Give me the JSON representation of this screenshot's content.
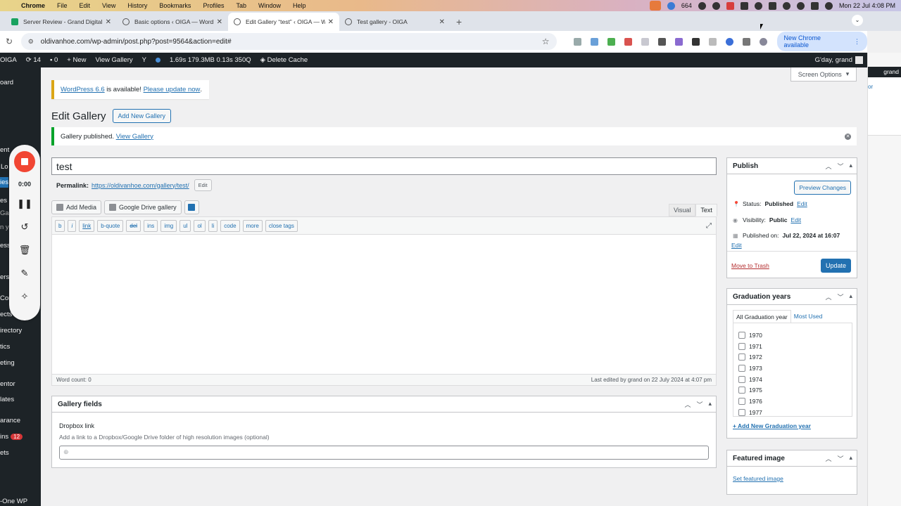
{
  "mac": {
    "menu": [
      "Chrome",
      "File",
      "Edit",
      "View",
      "History",
      "Bookmarks",
      "Profiles",
      "Tab",
      "Window",
      "Help"
    ],
    "count": "664",
    "datetime": "Mon 22 Jul  4:08 PM"
  },
  "tabs": [
    {
      "title": "Server Review - Grand Digital",
      "icon": "sheets-icon"
    },
    {
      "title": "Basic options ‹ OIGA — WordPress",
      "icon": "wordpress-icon"
    },
    {
      "title": "Edit Gallery “test” ‹ OIGA — WordPress",
      "icon": "wordpress-icon"
    },
    {
      "title": "Test gallery - OIGA",
      "icon": "wordpress-icon"
    }
  ],
  "address": {
    "url": "oldivanhoe.com/wp-admin/post.php?post=9564&action=edit#",
    "new_chrome": "New Chrome available"
  },
  "adminbar": {
    "site": "OIGA",
    "updates": "14",
    "comments": "0",
    "new": "New",
    "view_gallery": "View Gallery",
    "perf": "1.69s  179.3MB  0.13s  350Q",
    "delete_cache": "Delete Cache",
    "greeting": "G'day, grand"
  },
  "sidemenu": {
    "items": [
      "oard",
      "Lo",
      "ies",
      "es",
      "Gal",
      "n y",
      "ent",
      "ess",
      "ers",
      "Con",
      "ects",
      "irectory",
      "tics",
      "eting",
      "entor",
      "lates",
      "arance",
      "ins",
      "ets",
      "-One WP"
    ],
    "plugin_count": "12"
  },
  "recorder": {
    "time": "0:00"
  },
  "rightstrip": {
    "greeting": "grand",
    "link": "or"
  },
  "screen_options": "Screen Options",
  "update_notice": {
    "version": "WordPress 6.6",
    "middle": " is available! ",
    "link": "Please update now",
    "end": "."
  },
  "page": {
    "title": "Edit Gallery",
    "add_new": "Add New Gallery",
    "notice": "Gallery published. ",
    "notice_link": "View Gallery",
    "post_title": "test",
    "permalink_label": "Permalink:",
    "permalink_url": "https://oldivanhoe.com/gallery/test/",
    "permalink_edit": "Edit"
  },
  "editor": {
    "add_media": "Add Media",
    "google_drive": "Google Drive gallery",
    "tab_visual": "Visual",
    "tab_text": "Text",
    "quicktags": [
      "b",
      "i",
      "link",
      "b-quote",
      "del",
      "ins",
      "img",
      "ul",
      "ol",
      "li",
      "code",
      "more",
      "close tags"
    ],
    "word_count": "Word count: 0",
    "last_edited": "Last edited by grand on 22 July 2024 at 4:07 pm"
  },
  "gallery_fields": {
    "title": "Gallery fields",
    "label": "Dropbox link",
    "desc": "Add a link to a Dropbox/Google Drive folder of high resolution images (optional)"
  },
  "publish": {
    "title": "Publish",
    "preview": "Preview Changes",
    "status_label": "Status:",
    "status": "Published",
    "visibility_label": "Visibility:",
    "visibility": "Public",
    "published_label": "Published on:",
    "published": "Jul 22, 2024 at 16:07",
    "edit": "Edit",
    "trash": "Move to Trash",
    "update": "Update"
  },
  "graduation": {
    "title": "Graduation years",
    "tab_all": "All Graduation year",
    "tab_most": "Most Used",
    "years": [
      "1970",
      "1971",
      "1972",
      "1973",
      "1974",
      "1975",
      "1976",
      "1977"
    ],
    "add_new": "+ Add New Graduation year"
  },
  "featured": {
    "title": "Featured image",
    "set": "Set featured image"
  }
}
